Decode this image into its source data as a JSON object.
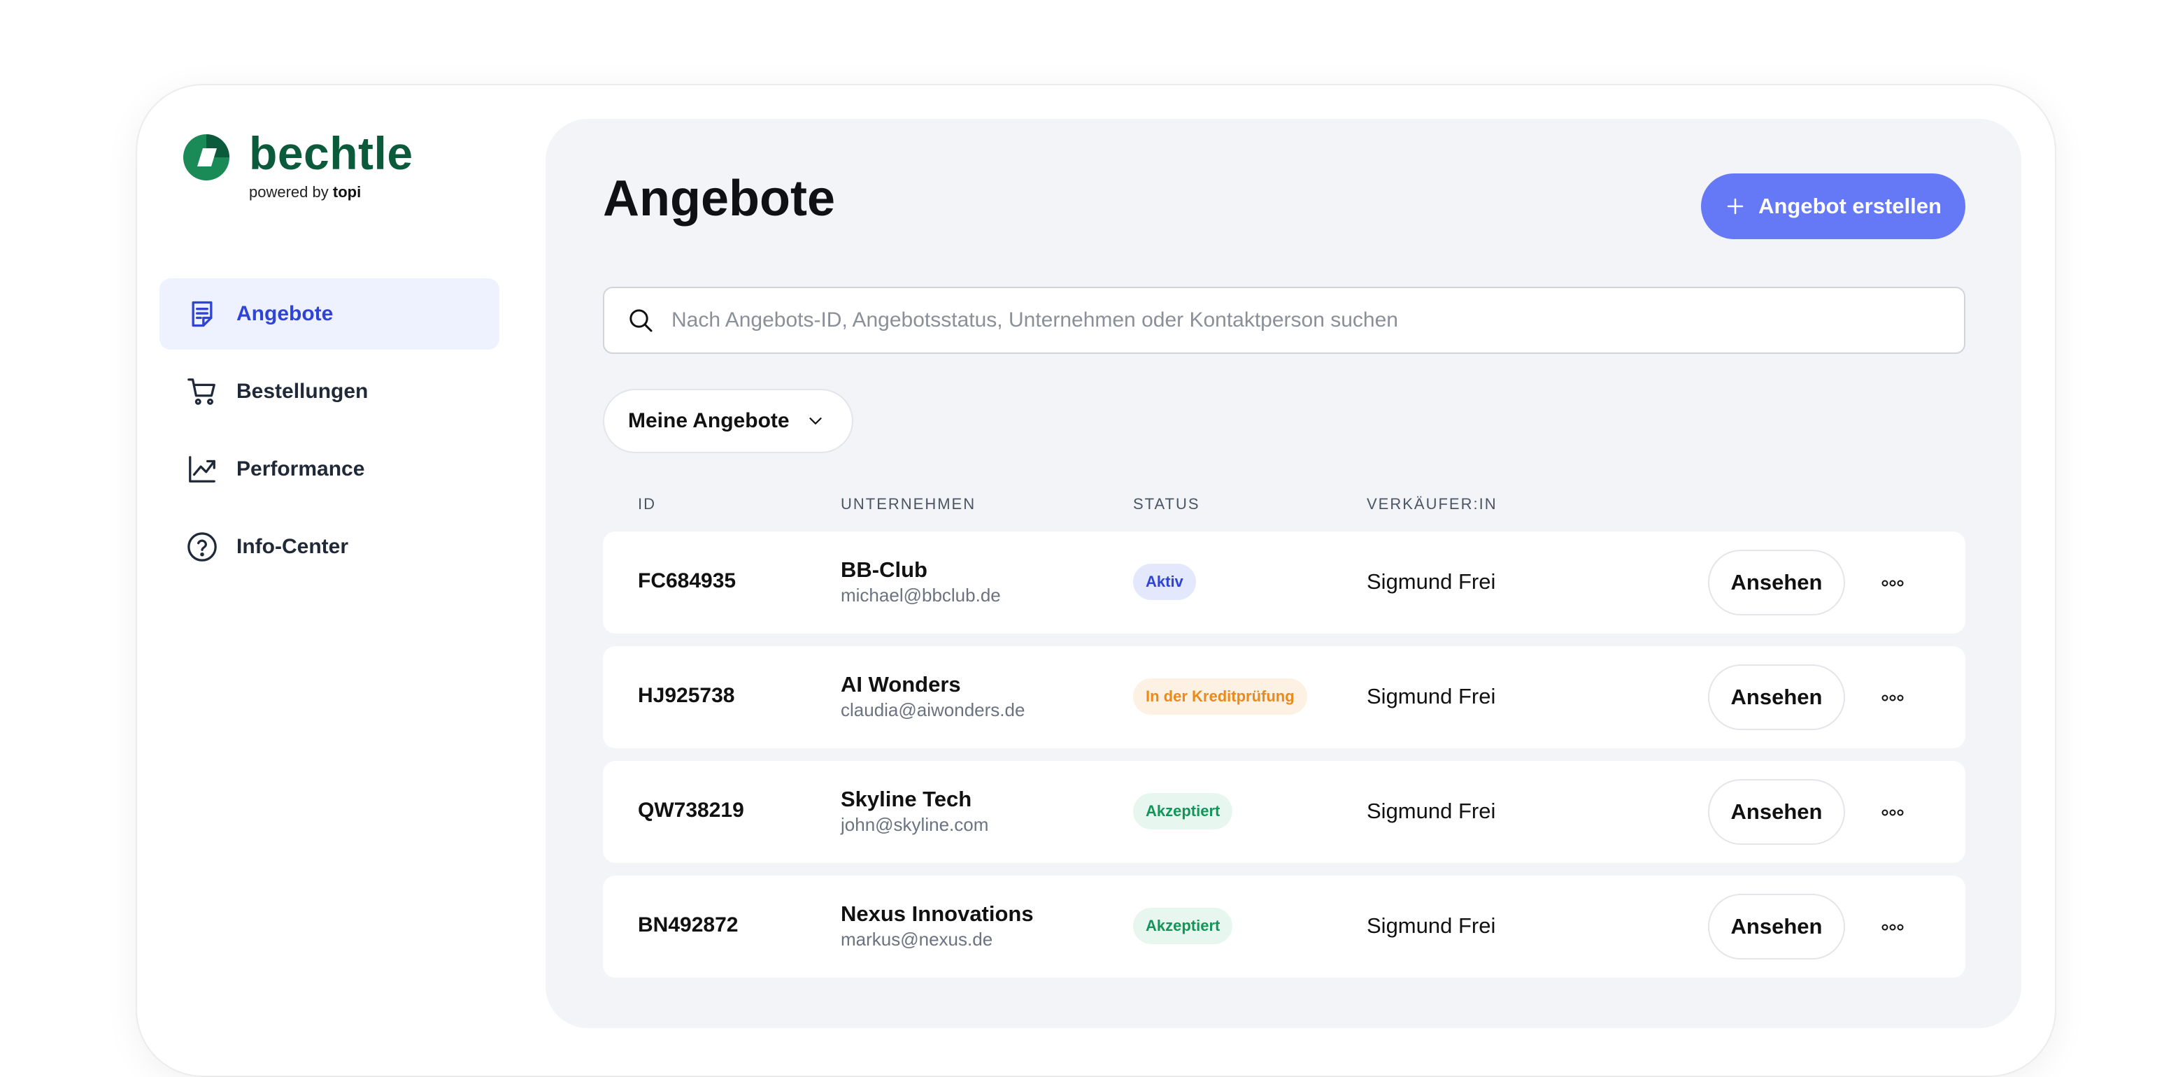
{
  "brand": {
    "name": "bechtle",
    "powered_prefix": "powered by",
    "powered_brand": "topi",
    "color": "#0b5a3c"
  },
  "sidebar": {
    "items": [
      {
        "label": "Angebote",
        "icon": "document-icon",
        "active": true
      },
      {
        "label": "Bestellungen",
        "icon": "cart-icon",
        "active": false
      },
      {
        "label": "Performance",
        "icon": "chart-trend-icon",
        "active": false
      },
      {
        "label": "Info-Center",
        "icon": "help-circle-icon",
        "active": false
      }
    ]
  },
  "main": {
    "title": "Angebote",
    "create_button": "Angebot erstellen",
    "search_placeholder": "Nach Angebots-ID, Angebotsstatus, Unternehmen oder Kontaktperson suchen",
    "filter_label": "Meine Angebote",
    "table": {
      "headers": [
        "ID",
        "UNTERNEHMEN",
        "STATUS",
        "VERKÄUFER:IN"
      ],
      "rows": [
        {
          "id": "FC684935",
          "company": "BB-Club",
          "email": "michael@bbclub.de",
          "status": "Aktiv",
          "status_type": "aktiv",
          "seller": "Sigmund Frei",
          "action": "Ansehen"
        },
        {
          "id": "HJ925738",
          "company": "AI Wonders",
          "email": "claudia@aiwonders.de",
          "status": "In der Kreditprüfung",
          "status_type": "kredit",
          "seller": "Sigmund Frei",
          "action": "Ansehen"
        },
        {
          "id": "QW738219",
          "company": "Skyline Tech",
          "email": "john@skyline.com",
          "status": "Akzeptiert",
          "status_type": "akzept",
          "seller": "Sigmund Frei",
          "action": "Ansehen"
        },
        {
          "id": "BN492872",
          "company": "Nexus Innovations",
          "email": "markus@nexus.de",
          "status": "Akzeptiert",
          "status_type": "akzept",
          "seller": "Sigmund Frei",
          "action": "Ansehen"
        }
      ]
    }
  },
  "colors": {
    "accent": "#6578f6",
    "active_nav_bg": "#eef2fe",
    "active_nav_text": "#2f43d6",
    "panel_bg": "#f3f4f8"
  }
}
